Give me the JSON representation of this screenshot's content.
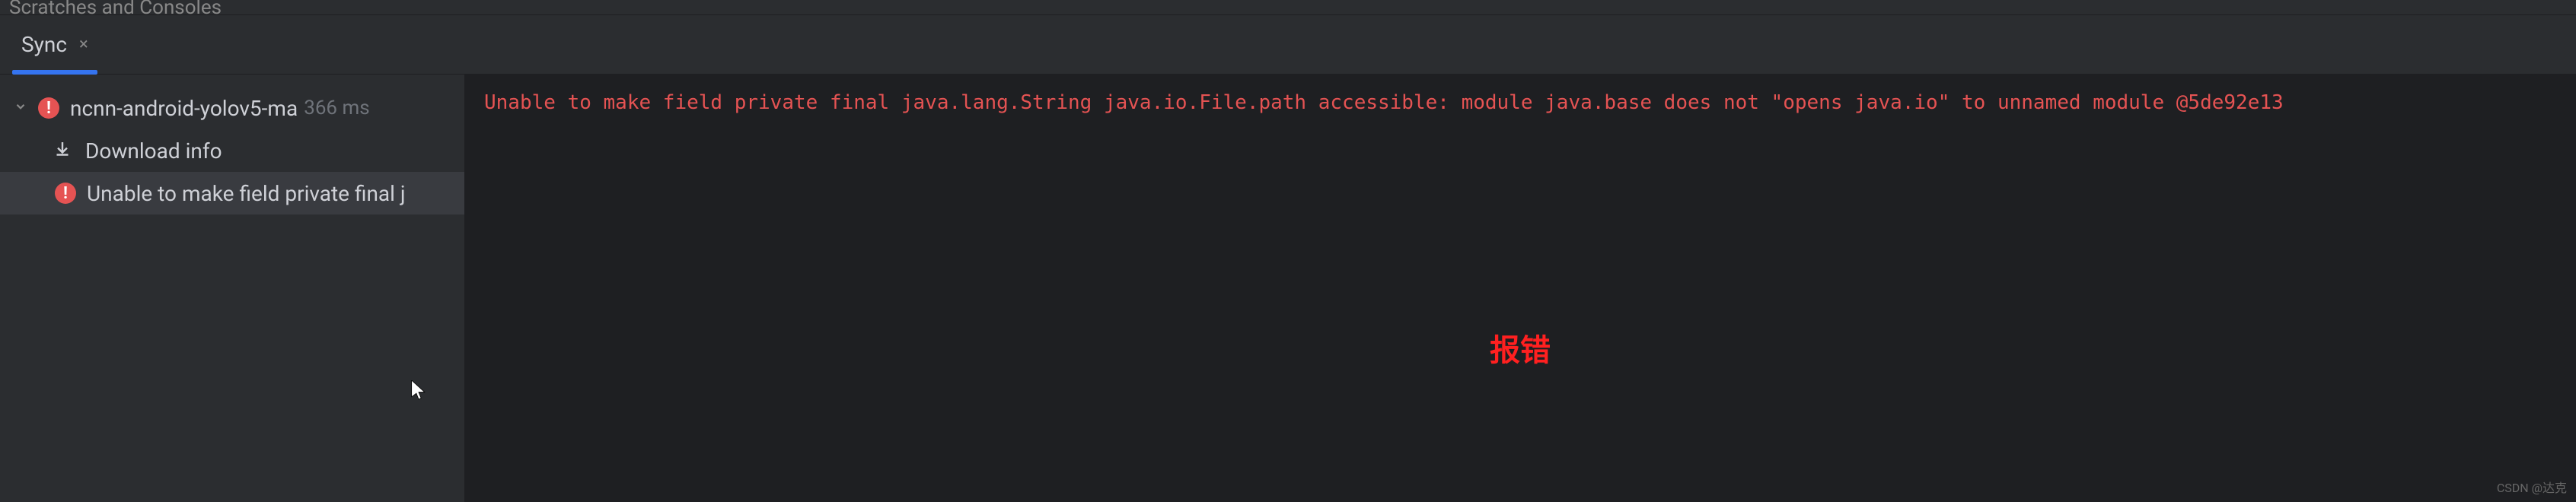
{
  "top": {
    "label": "Scratches and Consoles"
  },
  "tab": {
    "label": "Sync",
    "close": "×"
  },
  "sidebar": {
    "root": {
      "label": "ncnn-android-yolov5-ma",
      "time": "366 ms"
    },
    "download": {
      "label": "Download info"
    },
    "error_item": {
      "label": "Unable to make field private final j"
    }
  },
  "content": {
    "error": "Unable to make field private final java.lang.String java.io.File.path accessible: module java.base does not \"opens java.io\" to unnamed module @5de92e13"
  },
  "annotation": "报错",
  "watermark": "CSDN @达克"
}
